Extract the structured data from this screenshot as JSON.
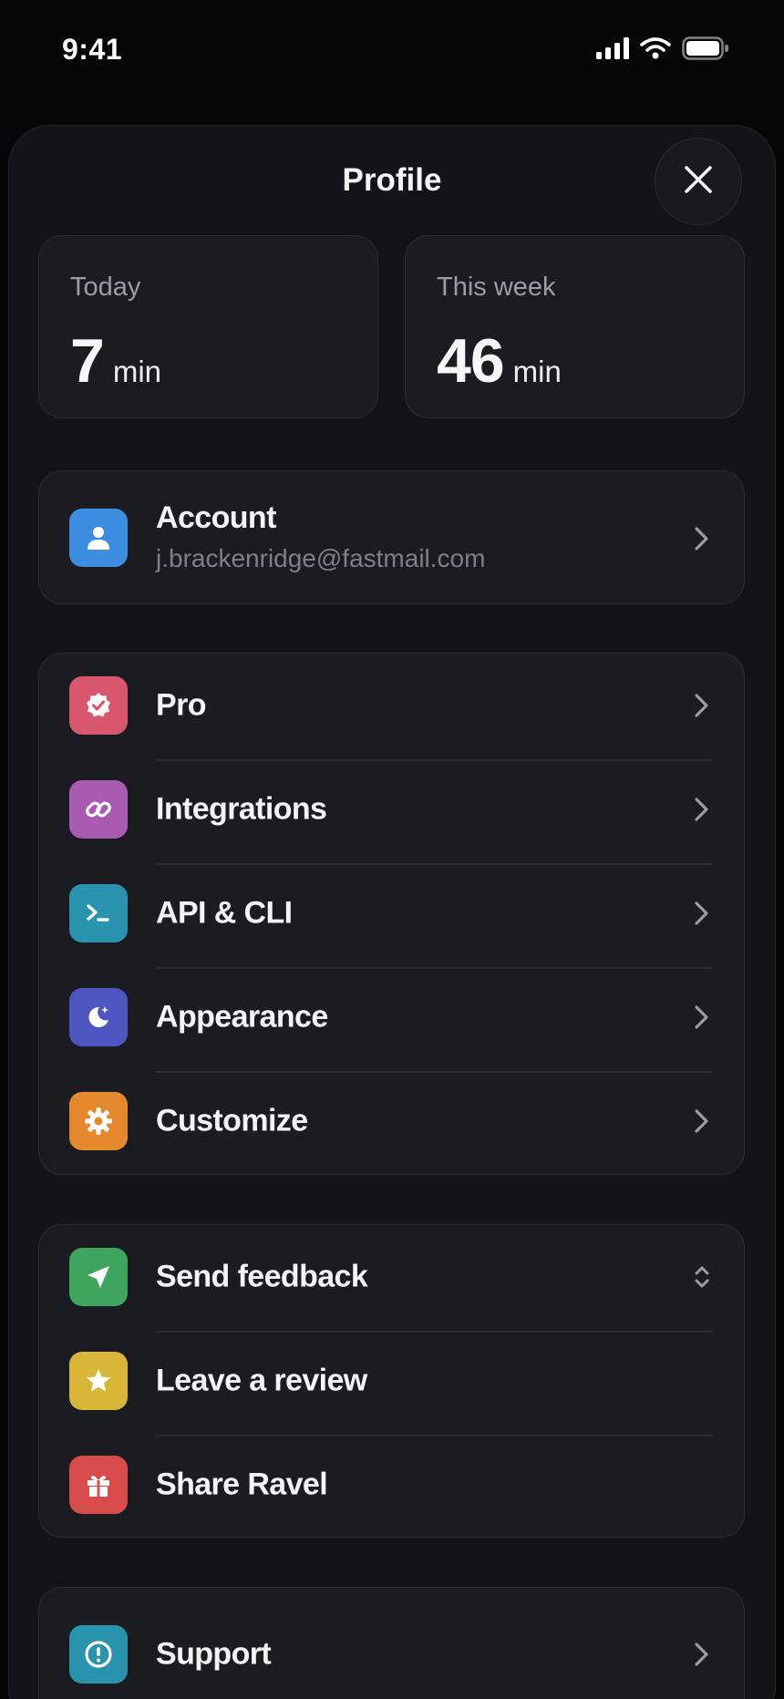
{
  "status_bar": {
    "time": "9:41"
  },
  "header": {
    "title": "Profile"
  },
  "stats": [
    {
      "label": "Today",
      "value": "7",
      "unit": "min"
    },
    {
      "label": "This week",
      "value": "46",
      "unit": "min"
    }
  ],
  "account": {
    "label": "Account",
    "email": "j.brackenridge@fastmail.com",
    "icon": "person-icon",
    "color": "#3d8ee0"
  },
  "settings_group": [
    {
      "label": "Pro",
      "icon": "verified-badge-icon",
      "color": "#d9566f"
    },
    {
      "label": "Integrations",
      "icon": "link-icon",
      "color": "#a85bb0"
    },
    {
      "label": "API & CLI",
      "icon": "terminal-icon",
      "color": "#2a93ad"
    },
    {
      "label": "Appearance",
      "icon": "moon-icon",
      "color": "#4f55c0"
    },
    {
      "label": "Customize",
      "icon": "gear-icon",
      "color": "#e6892e"
    }
  ],
  "community_group": [
    {
      "label": "Send feedback",
      "icon": "paper-plane-icon",
      "color": "#3ea55e"
    },
    {
      "label": "Leave a review",
      "icon": "star-icon",
      "color": "#d8b638"
    },
    {
      "label": "Share Ravel",
      "icon": "gift-icon",
      "color": "#d94c4c"
    }
  ],
  "support": {
    "label": "Support",
    "icon": "exclamation-circle-icon",
    "color": "#2a93ad"
  }
}
